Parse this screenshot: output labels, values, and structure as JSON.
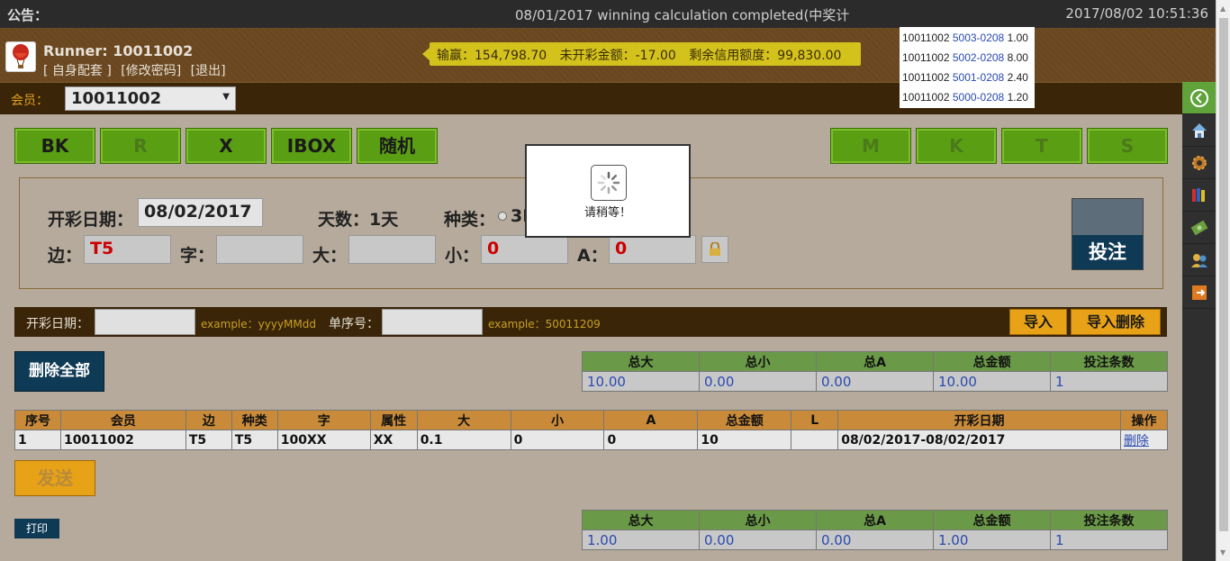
{
  "announcement": {
    "label": "公告：",
    "text": "08/01/2017 winning calculation completed(中奖计",
    "datetime": "2017/08/02 10:51:36"
  },
  "header": {
    "runner": "Runner: 10011002",
    "links": [
      "[ 自身配套 ]",
      "[修改密码]",
      "[退出]"
    ],
    "balance": {
      "winloss": "输赢：154,798.70",
      "unsettled": "未开彩金额：-17.00",
      "credit": "剩余信用额度：99,830.00"
    }
  },
  "member": {
    "label": "会员：",
    "selected": "10011002"
  },
  "mode_buttons_left": [
    "BK",
    "R",
    "X",
    "IBOX",
    "随机"
  ],
  "mode_buttons_right": [
    "M",
    "K",
    "T",
    "S"
  ],
  "entry": {
    "date_label": "开彩日期：",
    "date_value": "08/02/2017",
    "days_label": "天数：1天",
    "kind_label": "种类：",
    "kind_value": "3I",
    "side_label": "边：",
    "side_value": "T5",
    "char_label": "字：",
    "char_value": "",
    "big_label": "大：",
    "big_value": "",
    "small_label": "小：",
    "small_value": "0",
    "a_label": "A：",
    "a_value": "0",
    "bet_button": "投注"
  },
  "import": {
    "date_label": "开彩日期：",
    "date_example": "example：yyyyMMdd",
    "serial_label": "单序号：",
    "serial_example": "example：50011209",
    "import_button": "导入",
    "import_delete_button": "导入删除"
  },
  "delete_all_button": "删除全部",
  "summary_headers": [
    "总大",
    "总小",
    "总A",
    "总金额",
    "投注条数"
  ],
  "summary_top": [
    "10.00",
    "0.00",
    "0.00",
    "10.00",
    "1"
  ],
  "summary_bottom": [
    "1.00",
    "0.00",
    "0.00",
    "1.00",
    "1"
  ],
  "bets_table": {
    "headers": [
      "序号",
      "会员",
      "边",
      "种类",
      "字",
      "属性",
      "大",
      "小",
      "A",
      "总金额",
      "L",
      "开彩日期",
      "操作"
    ],
    "rows": [
      [
        "1",
        "10011002",
        "T5",
        "T5",
        "100XX",
        "XX",
        "0.1",
        "0",
        "0",
        "10",
        "",
        "08/02/2017-08/02/2017",
        "删除"
      ]
    ]
  },
  "send_button": "发送",
  "print_button": "打印",
  "recent": [
    {
      "member": "10011002",
      "code": "5003-0208",
      "amount": "1.00"
    },
    {
      "member": "10011002",
      "code": "5002-0208",
      "amount": "8.00"
    },
    {
      "member": "10011002",
      "code": "5001-0208",
      "amount": "2.40"
    },
    {
      "member": "10011002",
      "code": "5000-0208",
      "amount": "1.20"
    }
  ],
  "wait_dialog": {
    "message": "请稍等！"
  },
  "colors": {
    "accent_green": "#5a9f13",
    "navy": "#0f3a55",
    "orange": "#e8a217",
    "brown": "#3a2508"
  }
}
